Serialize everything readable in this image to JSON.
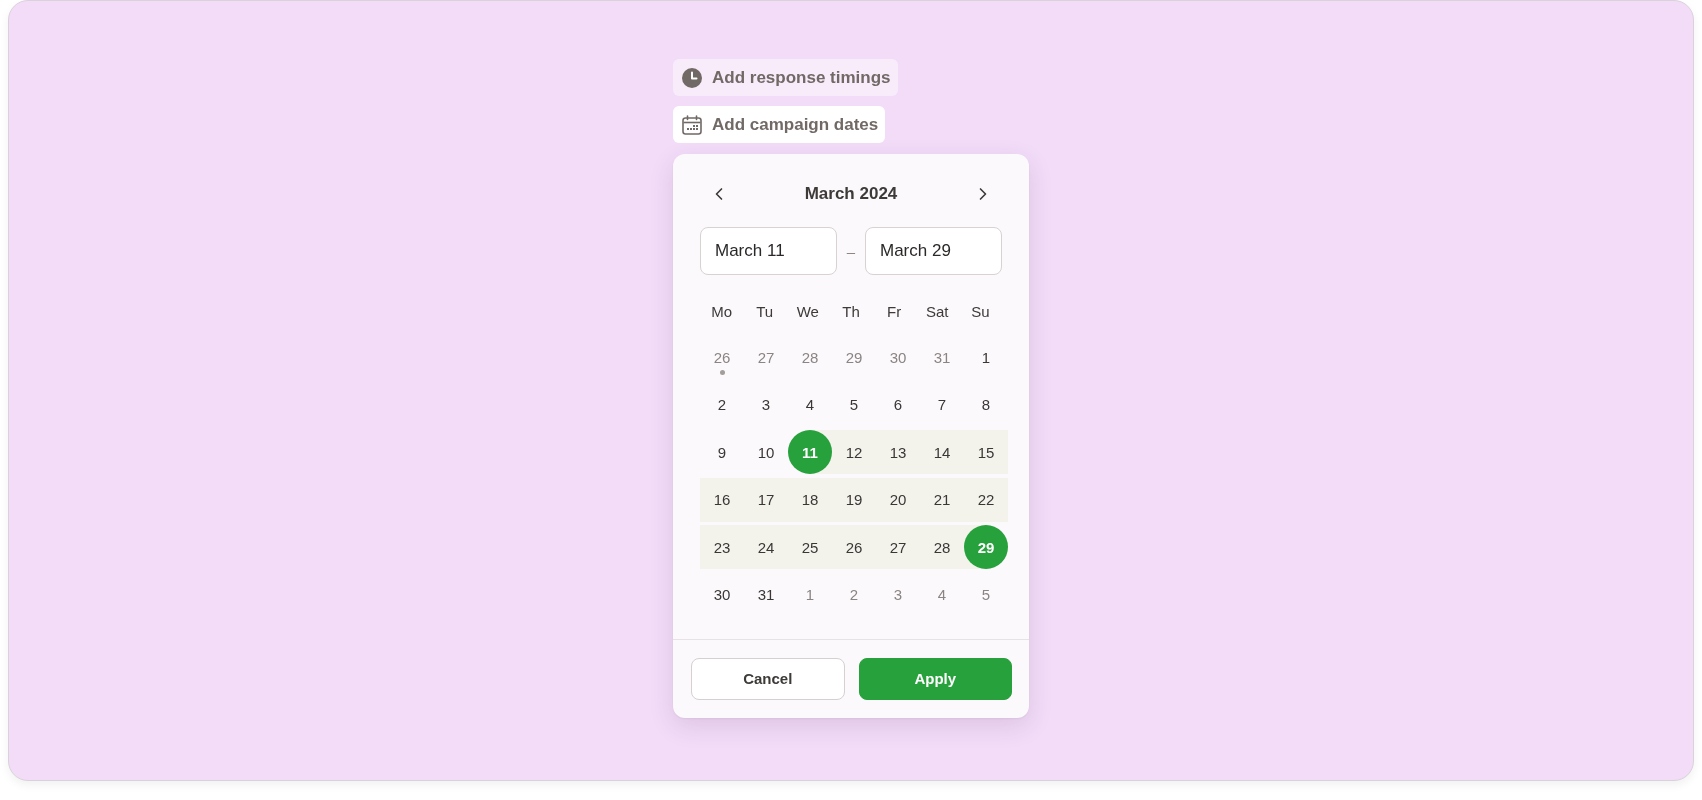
{
  "actions": [
    {
      "label": "Add response timings",
      "kind": "clock",
      "expanded": false
    },
    {
      "label": "Add campaign dates",
      "kind": "calendar",
      "expanded": true
    }
  ],
  "date_picker": {
    "month_title": "March 2024",
    "range_start": "March 11",
    "range_separator": "–",
    "range_end": "March 29",
    "weekdays": [
      "Mo",
      "Tu",
      "We",
      "Th",
      "Fr",
      "Sat",
      "Su"
    ],
    "weeks": [
      [
        {
          "label": "26",
          "outside": true,
          "selected": false,
          "in_range": false,
          "marked": true
        },
        {
          "label": "27",
          "outside": true,
          "selected": false,
          "in_range": false,
          "marked": false
        },
        {
          "label": "28",
          "outside": true,
          "selected": false,
          "in_range": false,
          "marked": false
        },
        {
          "label": "29",
          "outside": true,
          "selected": false,
          "in_range": false,
          "marked": false
        },
        {
          "label": "30",
          "outside": true,
          "selected": false,
          "in_range": false,
          "marked": false
        },
        {
          "label": "31",
          "outside": true,
          "selected": false,
          "in_range": false,
          "marked": false
        },
        {
          "label": "1",
          "outside": false,
          "selected": false,
          "in_range": false,
          "marked": false
        }
      ],
      [
        {
          "label": "2",
          "outside": false,
          "selected": false,
          "in_range": false,
          "marked": false
        },
        {
          "label": "3",
          "outside": false,
          "selected": false,
          "in_range": false,
          "marked": false
        },
        {
          "label": "4",
          "outside": false,
          "selected": false,
          "in_range": false,
          "marked": false
        },
        {
          "label": "5",
          "outside": false,
          "selected": false,
          "in_range": false,
          "marked": false
        },
        {
          "label": "6",
          "outside": false,
          "selected": false,
          "in_range": false,
          "marked": false
        },
        {
          "label": "7",
          "outside": false,
          "selected": false,
          "in_range": false,
          "marked": false
        },
        {
          "label": "8",
          "outside": false,
          "selected": false,
          "in_range": false,
          "marked": false
        }
      ],
      [
        {
          "label": "9",
          "outside": false,
          "selected": false,
          "in_range": false,
          "marked": false
        },
        {
          "label": "10",
          "outside": false,
          "selected": false,
          "in_range": false,
          "marked": false
        },
        {
          "label": "11",
          "outside": false,
          "selected": true,
          "in_range": false,
          "marked": false
        },
        {
          "label": "12",
          "outside": false,
          "selected": false,
          "in_range": true,
          "marked": false
        },
        {
          "label": "13",
          "outside": false,
          "selected": false,
          "in_range": true,
          "marked": false
        },
        {
          "label": "14",
          "outside": false,
          "selected": false,
          "in_range": true,
          "marked": false
        },
        {
          "label": "15",
          "outside": false,
          "selected": false,
          "in_range": true,
          "marked": false
        }
      ],
      [
        {
          "label": "16",
          "outside": false,
          "selected": false,
          "in_range": true,
          "marked": false
        },
        {
          "label": "17",
          "outside": false,
          "selected": false,
          "in_range": true,
          "marked": false
        },
        {
          "label": "18",
          "outside": false,
          "selected": false,
          "in_range": true,
          "marked": false
        },
        {
          "label": "19",
          "outside": false,
          "selected": false,
          "in_range": true,
          "marked": false
        },
        {
          "label": "20",
          "outside": false,
          "selected": false,
          "in_range": true,
          "marked": false
        },
        {
          "label": "21",
          "outside": false,
          "selected": false,
          "in_range": true,
          "marked": false
        },
        {
          "label": "22",
          "outside": false,
          "selected": false,
          "in_range": true,
          "marked": false
        }
      ],
      [
        {
          "label": "23",
          "outside": false,
          "selected": false,
          "in_range": true,
          "marked": false
        },
        {
          "label": "24",
          "outside": false,
          "selected": false,
          "in_range": true,
          "marked": false
        },
        {
          "label": "25",
          "outside": false,
          "selected": false,
          "in_range": true,
          "marked": false
        },
        {
          "label": "26",
          "outside": false,
          "selected": false,
          "in_range": true,
          "marked": false
        },
        {
          "label": "27",
          "outside": false,
          "selected": false,
          "in_range": true,
          "marked": false
        },
        {
          "label": "28",
          "outside": false,
          "selected": false,
          "in_range": true,
          "marked": false
        },
        {
          "label": "29",
          "outside": false,
          "selected": true,
          "in_range": false,
          "marked": false
        }
      ],
      [
        {
          "label": "30",
          "outside": false,
          "selected": false,
          "in_range": false,
          "marked": false
        },
        {
          "label": "31",
          "outside": false,
          "selected": false,
          "in_range": false,
          "marked": false
        },
        {
          "label": "1",
          "outside": true,
          "selected": false,
          "in_range": false,
          "marked": false
        },
        {
          "label": "2",
          "outside": true,
          "selected": false,
          "in_range": false,
          "marked": false
        },
        {
          "label": "3",
          "outside": true,
          "selected": false,
          "in_range": false,
          "marked": false
        },
        {
          "label": "4",
          "outside": true,
          "selected": false,
          "in_range": false,
          "marked": false
        },
        {
          "label": "5",
          "outside": true,
          "selected": false,
          "in_range": false,
          "marked": false
        }
      ]
    ],
    "buttons": [
      {
        "label": "Cancel",
        "kind": "secondary"
      },
      {
        "label": "Apply",
        "kind": "primary"
      }
    ]
  }
}
